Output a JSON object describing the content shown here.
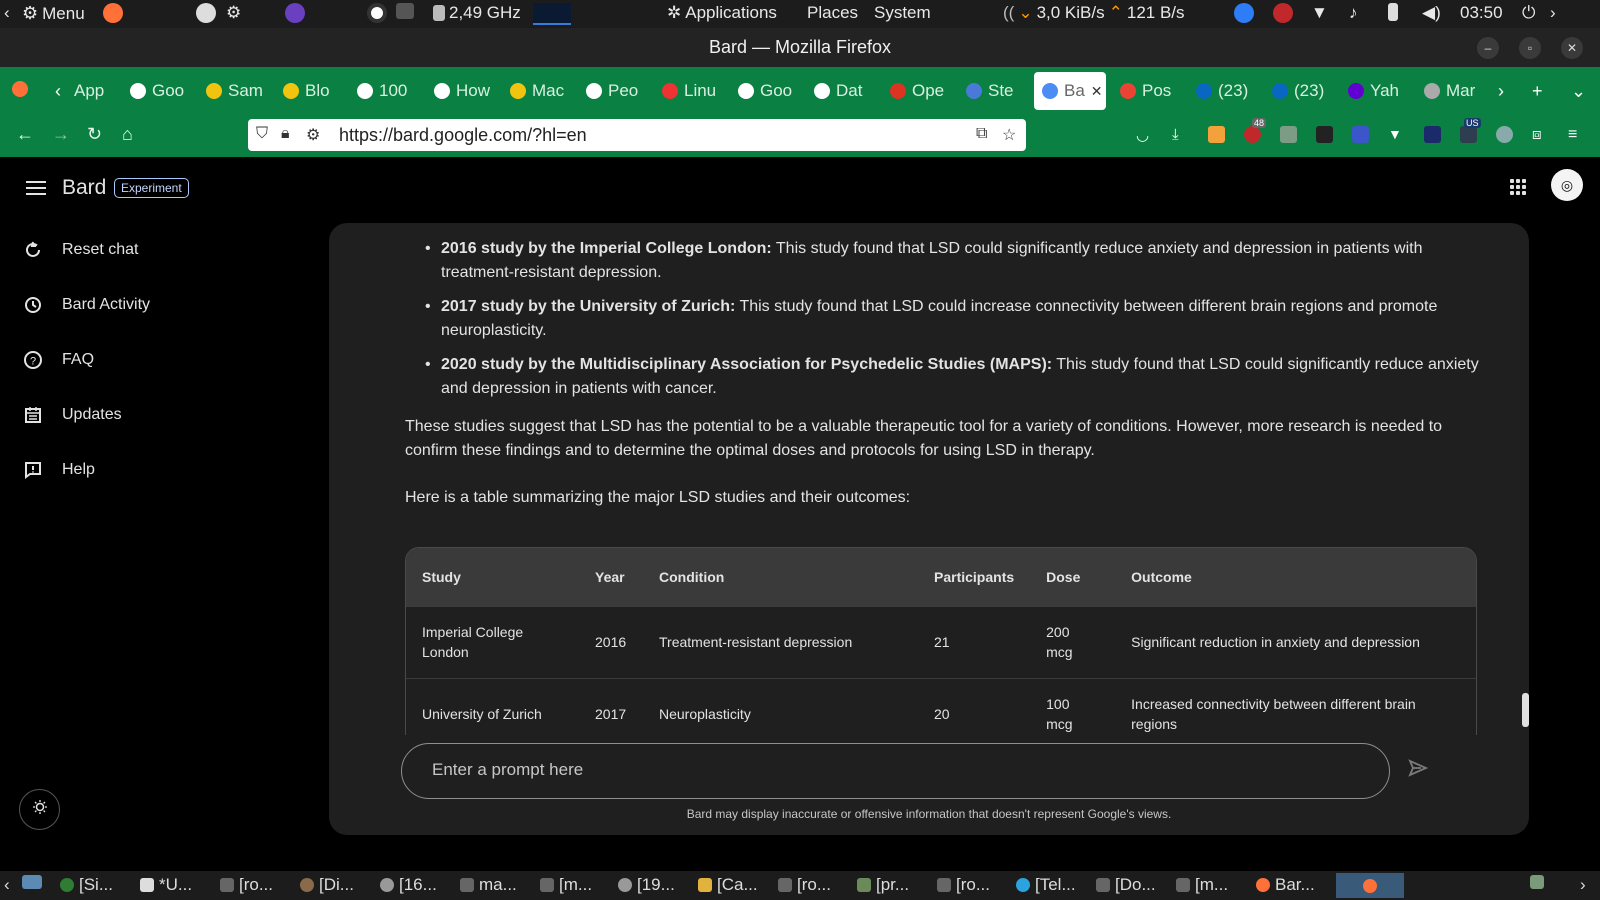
{
  "system_panel": {
    "menu_label": "Menu",
    "cpu_freq": "2,49 GHz",
    "menus": [
      "Applications",
      "Places",
      "System"
    ],
    "net_down": "3,0 KiB/s",
    "net_up": "121 B/s",
    "clock": "03:50"
  },
  "window": {
    "title": "Bard — Mozilla Firefox"
  },
  "tabs": [
    {
      "label": "App"
    },
    {
      "label": "Goo"
    },
    {
      "label": "Sam"
    },
    {
      "label": "Blo"
    },
    {
      "label": "100"
    },
    {
      "label": "How"
    },
    {
      "label": "Mac"
    },
    {
      "label": "Peo"
    },
    {
      "label": "Linu"
    },
    {
      "label": "Goo"
    },
    {
      "label": "Dat"
    },
    {
      "label": "Ope"
    },
    {
      "label": "Ste"
    },
    {
      "label": "Ba"
    },
    {
      "label": "Pos"
    },
    {
      "label": "(23)"
    },
    {
      "label": "(23)"
    },
    {
      "label": "Yah"
    },
    {
      "label": "Mar"
    }
  ],
  "nav": {
    "url": "https://bard.google.com/?hl=en",
    "ext_badge": "48",
    "ext_badge2": "US"
  },
  "app": {
    "brand": "Bard",
    "badge": "Experiment",
    "sidebar": [
      {
        "label": "Reset chat",
        "icon": "reset-icon"
      },
      {
        "label": "Bard Activity",
        "icon": "history-icon"
      },
      {
        "label": "FAQ",
        "icon": "help-circle-icon"
      },
      {
        "label": "Updates",
        "icon": "calendar-icon"
      },
      {
        "label": "Help",
        "icon": "feedback-icon"
      }
    ]
  },
  "response": {
    "bullets": [
      {
        "bold": "2016 study by the Imperial College London:",
        "text": " This study found that LSD could significantly reduce anxiety and depression in patients with treatment-resistant depression."
      },
      {
        "bold": "2017 study by the University of Zurich:",
        "text": " This study found that LSD could increase connectivity between different brain regions and promote neuroplasticity."
      },
      {
        "bold": "2020 study by the Multidisciplinary Association for Psychedelic Studies (MAPS):",
        "text": " This study found that LSD could significantly reduce anxiety and depression in patients with cancer."
      }
    ],
    "paragraph1": "These studies suggest that LSD has the potential to be a valuable therapeutic tool for a variety of conditions. However, more research is needed to confirm these findings and to determine the optimal doses and protocols for using LSD in therapy.",
    "paragraph2": "Here is a table summarizing the major LSD studies and their outcomes:",
    "table": {
      "headers": [
        "Study",
        "Year",
        "Condition",
        "Participants",
        "Dose",
        "Outcome"
      ],
      "rows": [
        [
          "Imperial College London",
          "2016",
          "Treatment-resistant depression",
          "21",
          "200 mcg",
          "Significant reduction in anxiety and depression"
        ],
        [
          "University of Zurich",
          "2017",
          "Neuroplasticity",
          "20",
          "100 mcg",
          "Increased connectivity between different brain regions"
        ]
      ]
    }
  },
  "prompt": {
    "placeholder": "Enter a prompt here"
  },
  "disclaimer": "Bard may display inaccurate or offensive information that doesn't represent Google's views.",
  "taskbar": [
    {
      "label": "[Si..."
    },
    {
      "label": "*U..."
    },
    {
      "label": "[ro..."
    },
    {
      "label": "[Di..."
    },
    {
      "label": "[16..."
    },
    {
      "label": "ma..."
    },
    {
      "label": "[m..."
    },
    {
      "label": "[19..."
    },
    {
      "label": "[Ca..."
    },
    {
      "label": "[ro..."
    },
    {
      "label": "[pr..."
    },
    {
      "label": "[ro..."
    },
    {
      "label": "[Tel..."
    },
    {
      "label": "[Do..."
    },
    {
      "label": "[m..."
    },
    {
      "label": "Bar..."
    }
  ],
  "colors": {
    "accent_green": "#0a8043",
    "panel_bg": "#1f1f1f"
  }
}
